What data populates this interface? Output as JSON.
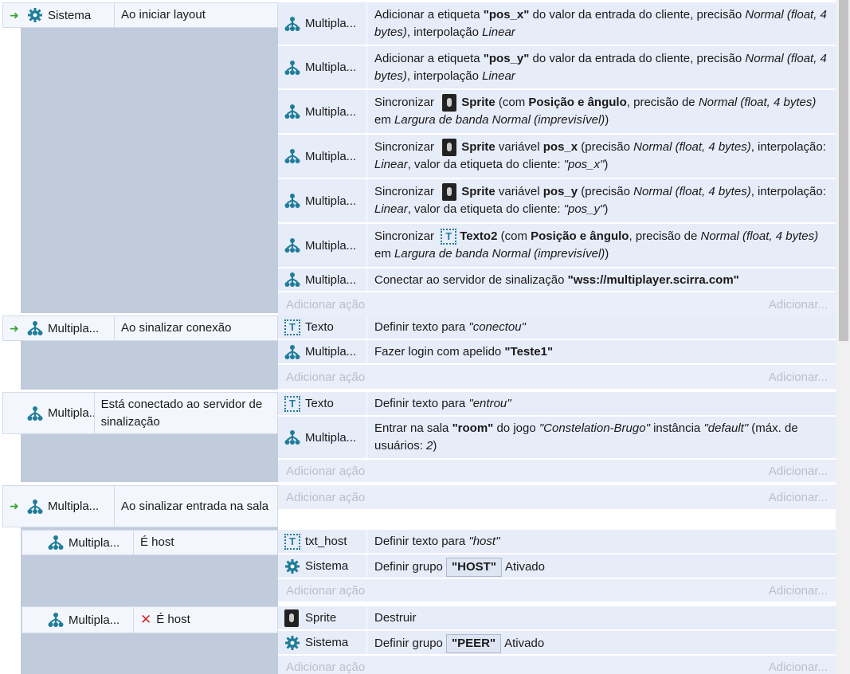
{
  "events": [
    {
      "condition": {
        "object": "Sistema",
        "text": "Ao iniciar layout"
      },
      "actions": [
        {
          "object": "Multipla...",
          "parts": [
            "Adicionar a etiqueta ",
            {
              "b": "\"pos_x\""
            },
            " do valor da entrada do cliente, precisão ",
            {
              "i": "Normal (float, 4 bytes)"
            },
            ", interpolação ",
            {
              "i": "Linear"
            }
          ]
        },
        {
          "object": "Multipla...",
          "parts": [
            "Adicionar a etiqueta ",
            {
              "b": "\"pos_y\""
            },
            " do valor da entrada do cliente, precisão ",
            {
              "i": "Normal (float, 4 bytes)"
            },
            ", interpolação ",
            {
              "i": "Linear"
            }
          ]
        },
        {
          "object": "Multipla...",
          "parts": [
            "Sincronizar ",
            {
              "sprite": true
            },
            {
              "b": "Sprite"
            },
            " (com ",
            {
              "b": "Posição e ângulo"
            },
            ", precisão de ",
            {
              "i": "Normal (float, 4 bytes)"
            },
            " em ",
            {
              "i": "Largura de banda Normal (imprevisível)"
            },
            ")"
          ]
        },
        {
          "object": "Multipla...",
          "parts": [
            "Sincronizar ",
            {
              "sprite": true
            },
            {
              "b": "Sprite"
            },
            " variável ",
            {
              "b": "pos_x"
            },
            " (precisão ",
            {
              "i": "Normal (float, 4 bytes)"
            },
            ", interpolação: ",
            {
              "i": "Linear"
            },
            ", valor da etiqueta do cliente: ",
            {
              "i": "\"pos_x\""
            },
            ")"
          ]
        },
        {
          "object": "Multipla...",
          "parts": [
            "Sincronizar ",
            {
              "sprite": true
            },
            {
              "b": "Sprite"
            },
            " variável ",
            {
              "b": "pos_y"
            },
            " (precisão ",
            {
              "i": "Normal (float, 4 bytes)"
            },
            ", interpolação: ",
            {
              "i": "Linear"
            },
            ", valor da etiqueta do cliente: ",
            {
              "i": "\"pos_y\""
            },
            ")"
          ]
        },
        {
          "object": "Multipla...",
          "parts": [
            "Sincronizar ",
            {
              "text": true
            },
            {
              "b": "Texto2"
            },
            " (com ",
            {
              "b": "Posição e ângulo"
            },
            ", precisão de ",
            {
              "i": "Normal (float, 4 bytes)"
            },
            " em ",
            {
              "i": "Largura de banda Normal (imprevisível)"
            },
            ")"
          ]
        },
        {
          "object": "Multipla...",
          "parts": [
            "Conectar ao servidor de sinalização ",
            {
              "b": "\"wss://multiplayer.scirra.com\""
            }
          ]
        }
      ]
    },
    {
      "condition": {
        "object": "Multipla...",
        "text": "Ao sinalizar conexão"
      },
      "actions": [
        {
          "object": "Texto",
          "parts": [
            "Definir texto para ",
            {
              "i": "\"conectou\""
            }
          ]
        },
        {
          "object": "Multipla...",
          "parts": [
            "Fazer login com apelido ",
            {
              "b": "\"Teste1\""
            }
          ]
        }
      ]
    },
    {
      "condition": {
        "object": "Multipla...",
        "text": "Está conectado ao servidor de sinalização"
      },
      "actions": [
        {
          "object": "Texto",
          "parts": [
            "Definir texto para ",
            {
              "i": "\"entrou\""
            }
          ]
        },
        {
          "object": "Multipla...",
          "parts": [
            "Entrar na sala ",
            {
              "b": "\"room\""
            },
            " do jogo ",
            {
              "i": "\"Constelation-Brugo\""
            },
            " instância ",
            {
              "i": "\"default\""
            },
            " (máx. de usuários: ",
            {
              "i": "2"
            },
            ")"
          ]
        }
      ]
    },
    {
      "condition": {
        "object": "Multipla...",
        "text": "Ao sinalizar entrada na sala"
      },
      "actions": []
    },
    {
      "condition": {
        "object": "Multipla...",
        "text": "É host"
      },
      "actions": [
        {
          "object": "txt_host",
          "parts": [
            "Definir texto para ",
            {
              "i": "\"host\""
            }
          ]
        },
        {
          "object": "Sistema",
          "parts": [
            "Definir grupo ",
            {
              "grp": "\"HOST\""
            },
            "Ativado"
          ]
        }
      ]
    },
    {
      "condition": {
        "object": "Multipla...",
        "text": "É host",
        "inverted": true
      },
      "actions": [
        {
          "object": "Sprite",
          "parts": [
            "Destruir"
          ]
        },
        {
          "object": "Sistema",
          "parts": [
            "Definir grupo ",
            {
              "grp": "\"PEER\""
            },
            "Ativado"
          ]
        }
      ]
    }
  ],
  "add_action_label": "Adicionar ação",
  "add_action_right_label": "Adicionar...",
  "icons": {
    "system": "gear-icon",
    "multiplayer": "network-icon",
    "text": "text-object-icon",
    "sprite": "sprite-icon",
    "trigger": "trigger-arrow-icon",
    "invert": "invert-x-icon"
  },
  "colors": {
    "event_block": "#c0cbdc",
    "action_row": "#e7ecf9",
    "trigger_arrow": "#3aa435",
    "system_gear": "#1f7d99",
    "invert_x": "#d62828"
  }
}
